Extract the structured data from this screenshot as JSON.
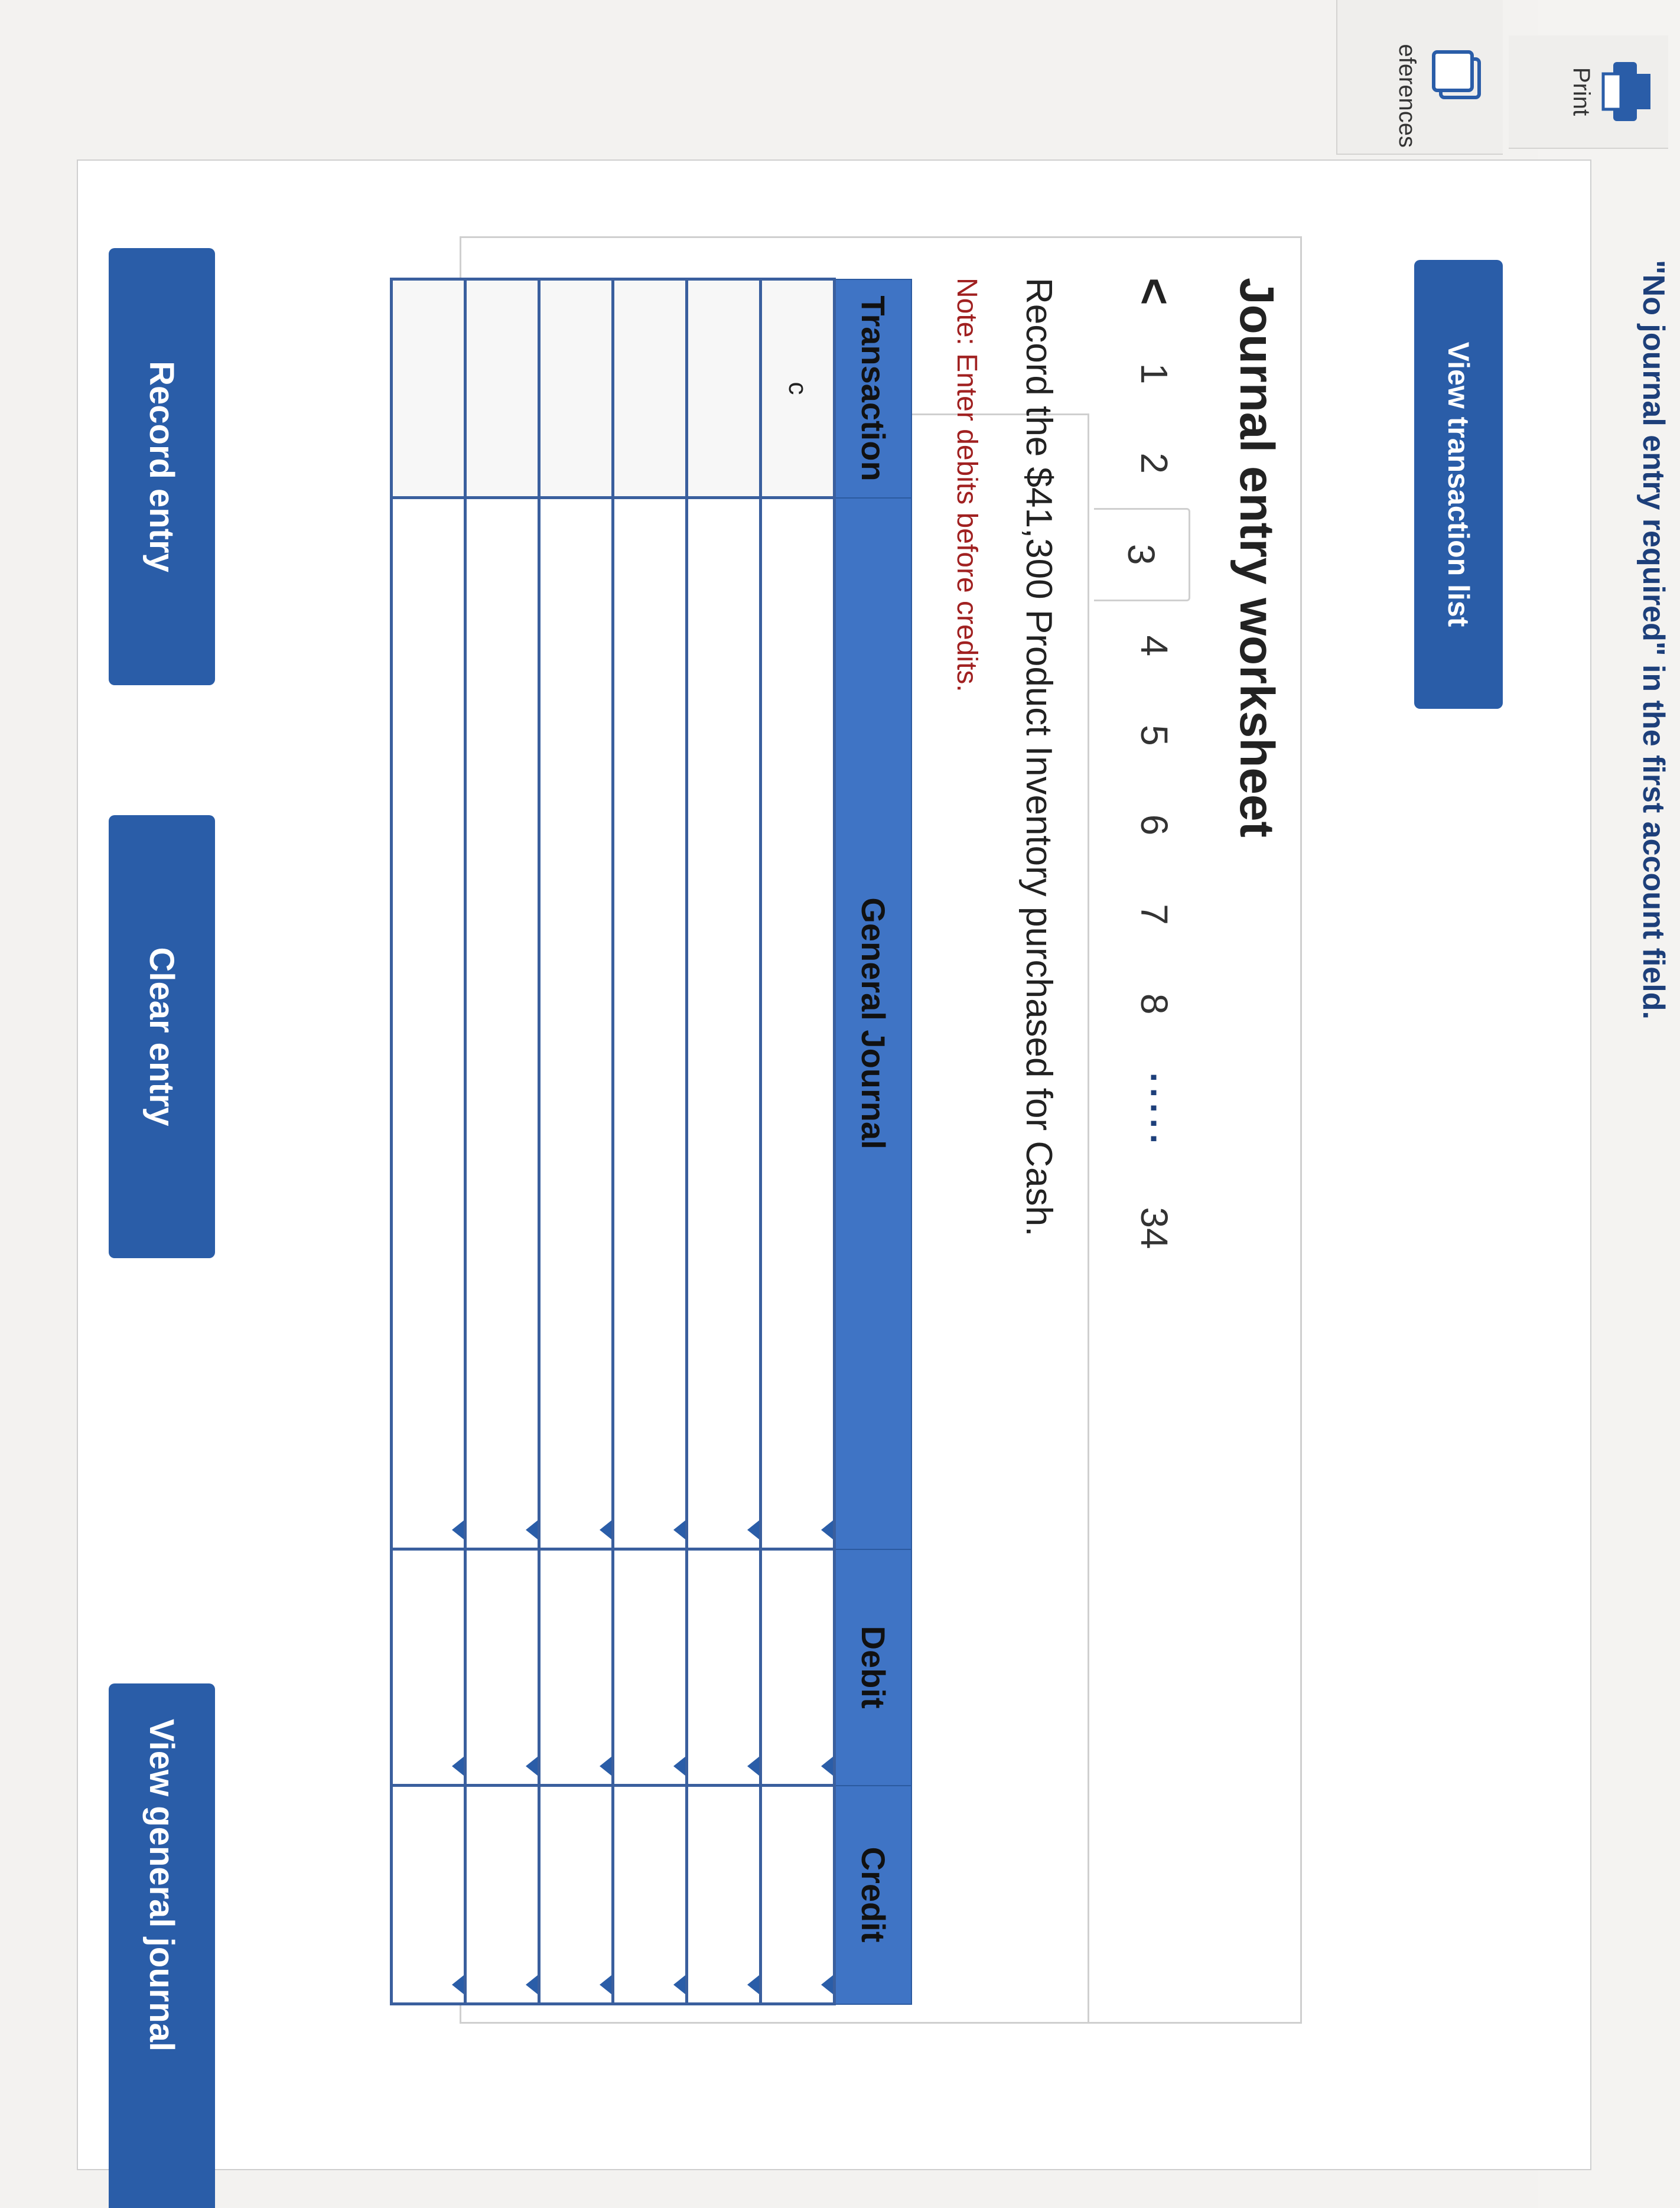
{
  "toolbar": {
    "print_label": "Print",
    "references_label": "eferences"
  },
  "header": {
    "top_banner_text": "\"No journal entry required\" in the first account field."
  },
  "buttons": {
    "view_transaction_list": "View transaction list",
    "record_entry": "Record entry",
    "clear_entry": "Clear entry",
    "view_general_journal": "View general journal"
  },
  "worksheet": {
    "title": "Journal entry worksheet",
    "prev_label": "<",
    "tabs": [
      "1",
      "2",
      "3",
      "4",
      "5",
      "6",
      "7",
      "8"
    ],
    "active_tab": "3",
    "ellipsis": "·····",
    "last_tab": "34",
    "instruction": "Record the $41,300 Product Inventory purchased for Cash.",
    "note": "Note: Enter debits before credits."
  },
  "table": {
    "headers": [
      "Transaction",
      "General Journal",
      "Debit",
      "Credit"
    ],
    "rows": [
      {
        "transaction": "c",
        "account": "",
        "debit": "",
        "credit": ""
      },
      {
        "transaction": "",
        "account": "",
        "debit": "",
        "credit": ""
      },
      {
        "transaction": "",
        "account": "",
        "debit": "",
        "credit": ""
      },
      {
        "transaction": "",
        "account": "",
        "debit": "",
        "credit": ""
      },
      {
        "transaction": "",
        "account": "",
        "debit": "",
        "credit": ""
      },
      {
        "transaction": "",
        "account": "",
        "debit": "",
        "credit": ""
      }
    ]
  },
  "colors": {
    "primary_button": "#2a5da8",
    "table_header": "#3f74c5",
    "note_text": "#a02020"
  },
  "icons": {
    "print": "printer-icon",
    "references": "references-icon",
    "dropdown": "dropdown-arrow-icon",
    "prev": "chevron-left-icon"
  }
}
